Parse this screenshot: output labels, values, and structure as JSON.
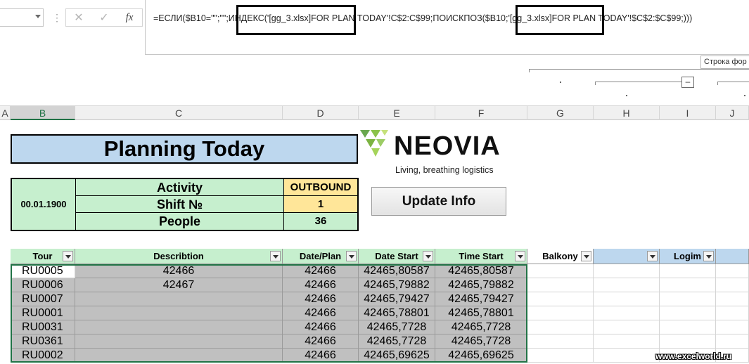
{
  "formula_bar": {
    "formula": "=ЕСЛИ($B10=\"\";\"\";ИНДЕКС('[gg_3.xlsx]FOR PLAN TODAY'!C$2:C$99;ПОИСКПОЗ($B10;'[gg_3.xlsx]FOR PLAN TODAY'!$C$2:$C$99;)))",
    "cancel_glyph": "✕",
    "enter_glyph": "✓",
    "fx_glyph": "fx",
    "dots": "⋮",
    "tooltip": "Строка фор"
  },
  "outline": {
    "collapse_glyph": "–"
  },
  "columns": [
    "A",
    "B",
    "C",
    "D",
    "E",
    "F",
    "G",
    "H",
    "I",
    "J"
  ],
  "sheet": {
    "title": "Planning Today",
    "date": "00.01.1900",
    "info_rows": [
      {
        "label": "Activity",
        "value": "OUTBOUND"
      },
      {
        "label": "Shift №",
        "value": "1"
      },
      {
        "label": "People",
        "value": "36"
      }
    ],
    "logo": {
      "word": "NEOVIA",
      "tagline": "Living, breathing logistics"
    },
    "update_button": "Update Info",
    "colors": {
      "green_fill": "#c6efce",
      "blue_fill": "#bdd7ee",
      "amber_fill": "#ffe699",
      "grey_fill": "#c0c0c0",
      "excel_green": "#217346"
    }
  },
  "table": {
    "headers": [
      "Tour",
      "Describtion",
      "Date/Plan",
      "Date Start",
      "Time Start",
      "Balkony",
      "",
      "Logim"
    ],
    "rows": [
      {
        "tour": "RU0005",
        "desc": "42466",
        "plan": "42466",
        "dstart": "42465,80587",
        "tstart": "42465,80587"
      },
      {
        "tour": "RU0006",
        "desc": "42467",
        "plan": "42466",
        "dstart": "42465,79882",
        "tstart": "42465,79882"
      },
      {
        "tour": "RU0007",
        "desc": "",
        "plan": "42466",
        "dstart": "42465,79427",
        "tstart": "42465,79427"
      },
      {
        "tour": "RU0001",
        "desc": "",
        "plan": "42466",
        "dstart": "42465,78801",
        "tstart": "42465,78801"
      },
      {
        "tour": "RU0031",
        "desc": "",
        "plan": "42466",
        "dstart": "42465,7728",
        "tstart": "42465,7728"
      },
      {
        "tour": "RU0361",
        "desc": "",
        "plan": "42466",
        "dstart": "42465,7728",
        "tstart": "42465,7728"
      },
      {
        "tour": "RU0002",
        "desc": "",
        "plan": "42466",
        "dstart": "42465,69625",
        "tstart": "42465,69625"
      }
    ]
  },
  "watermark": "www.excelworld.ru"
}
